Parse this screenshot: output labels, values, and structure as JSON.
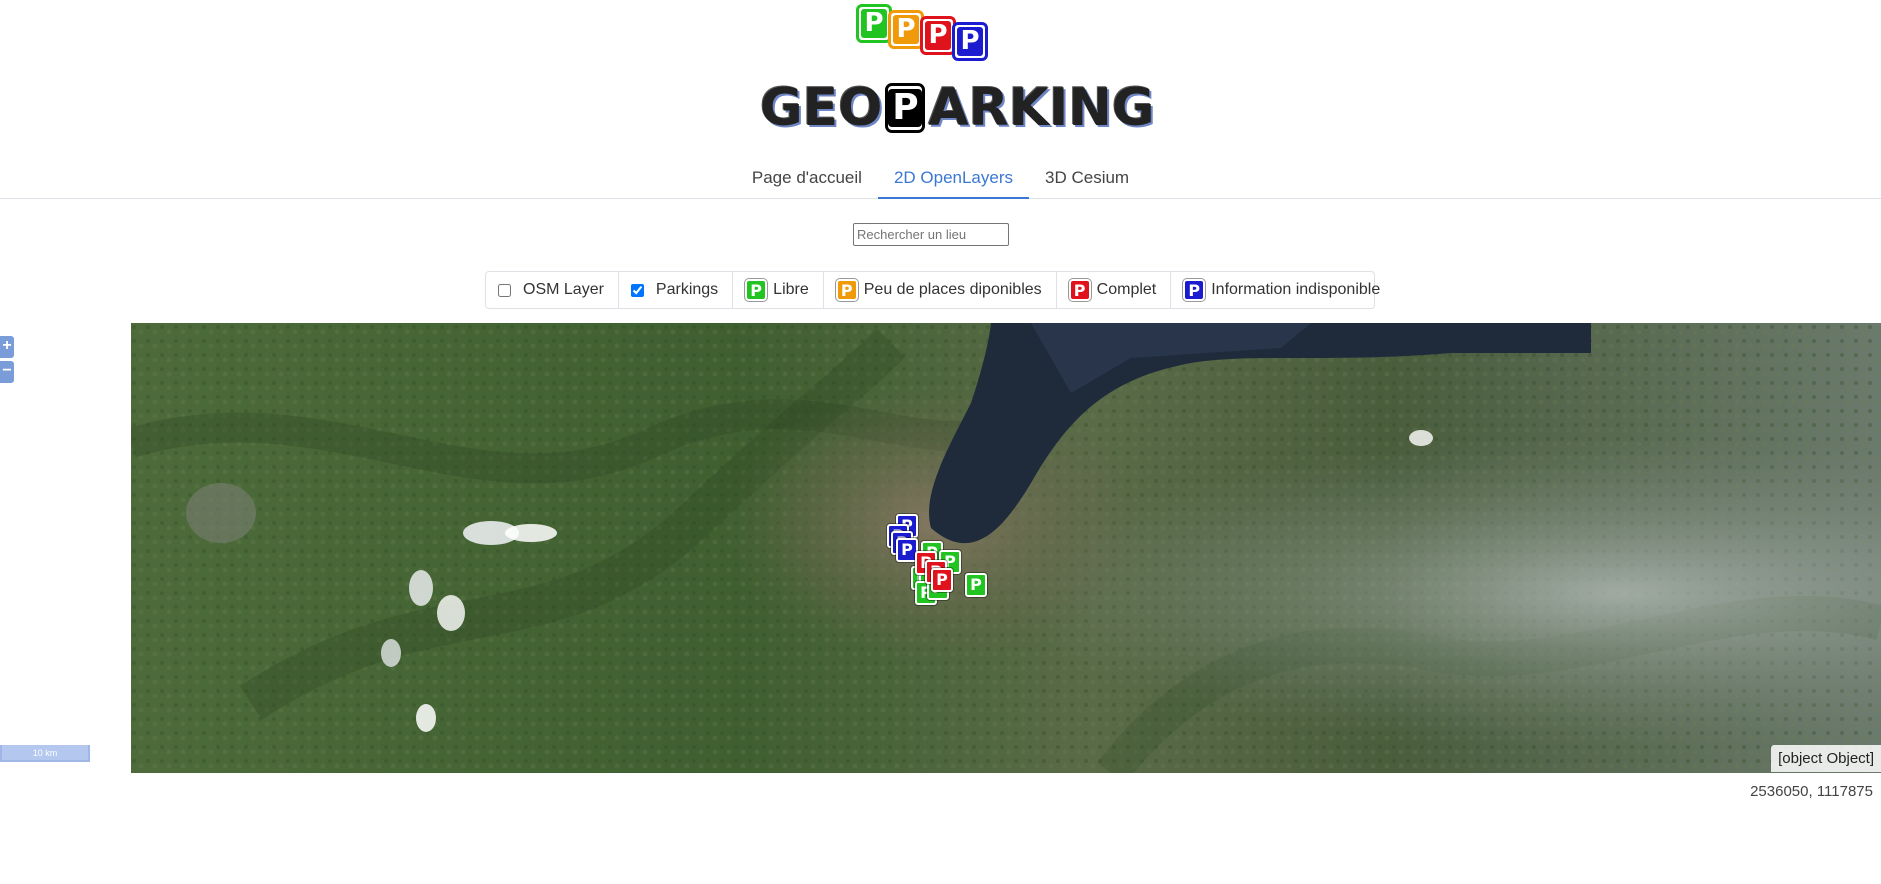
{
  "colors": {
    "libre": "#21c421",
    "peu": "#f19a09",
    "complet": "#e0121b",
    "indisponible": "#1b1bd0",
    "black": "#000000",
    "accent": "#3a78d4"
  },
  "logo": {
    "mini_letters": [
      "P",
      "P",
      "P",
      "P"
    ],
    "word_left": "GEO",
    "word_p": "P",
    "word_right": "ARKING"
  },
  "nav": {
    "tabs": [
      {
        "label": "Page d'accueil",
        "active": false
      },
      {
        "label": "2D OpenLayers",
        "active": true
      },
      {
        "label": "3D Cesium",
        "active": false
      }
    ]
  },
  "search": {
    "placeholder": "Rechercher un lieu",
    "value": ""
  },
  "legend": {
    "osm_label": "OSM Layer",
    "osm_checked": false,
    "parkings_label": "Parkings",
    "parkings_checked": true,
    "libre_label": "Libre",
    "peu_label": "Peu de places diponibles",
    "complet_label": "Complet",
    "indisponible_label": "Information indisponible",
    "marker_letter": "P"
  },
  "map": {
    "zoom_in": "+",
    "zoom_out": "−",
    "scale_label": "10 km",
    "attribution": "[object Object]",
    "mouse_position": "2536050, 1117875",
    "marker_status_counts": {
      "libre": 7,
      "complet": 3,
      "indisponible": 4
    }
  }
}
